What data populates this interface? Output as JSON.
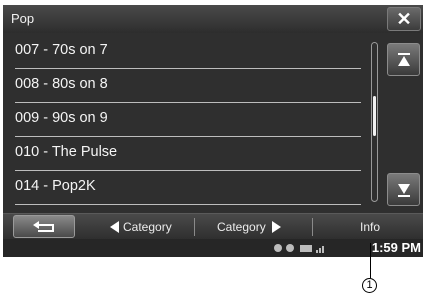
{
  "header": {
    "title": "Pop"
  },
  "list": {
    "items": [
      {
        "label": "007 - 70s on 7"
      },
      {
        "label": "008 - 80s on 8"
      },
      {
        "label": "009 - 90s on 9"
      },
      {
        "label": "010 - The Pulse"
      },
      {
        "label": "014 - Pop2K"
      }
    ],
    "scroll_position": 0.45
  },
  "bottombar": {
    "prev_category_label": "Category",
    "next_category_label": "Category",
    "info_label": "Info"
  },
  "statusbar": {
    "time": "1:59 PM"
  },
  "callout": {
    "number": "1"
  },
  "icons": {
    "close": "close-icon",
    "scroll_up": "scroll-top-icon",
    "scroll_down": "scroll-bottom-icon",
    "back": "return-icon",
    "prev": "triangle-left-icon",
    "next": "triangle-right-icon"
  }
}
